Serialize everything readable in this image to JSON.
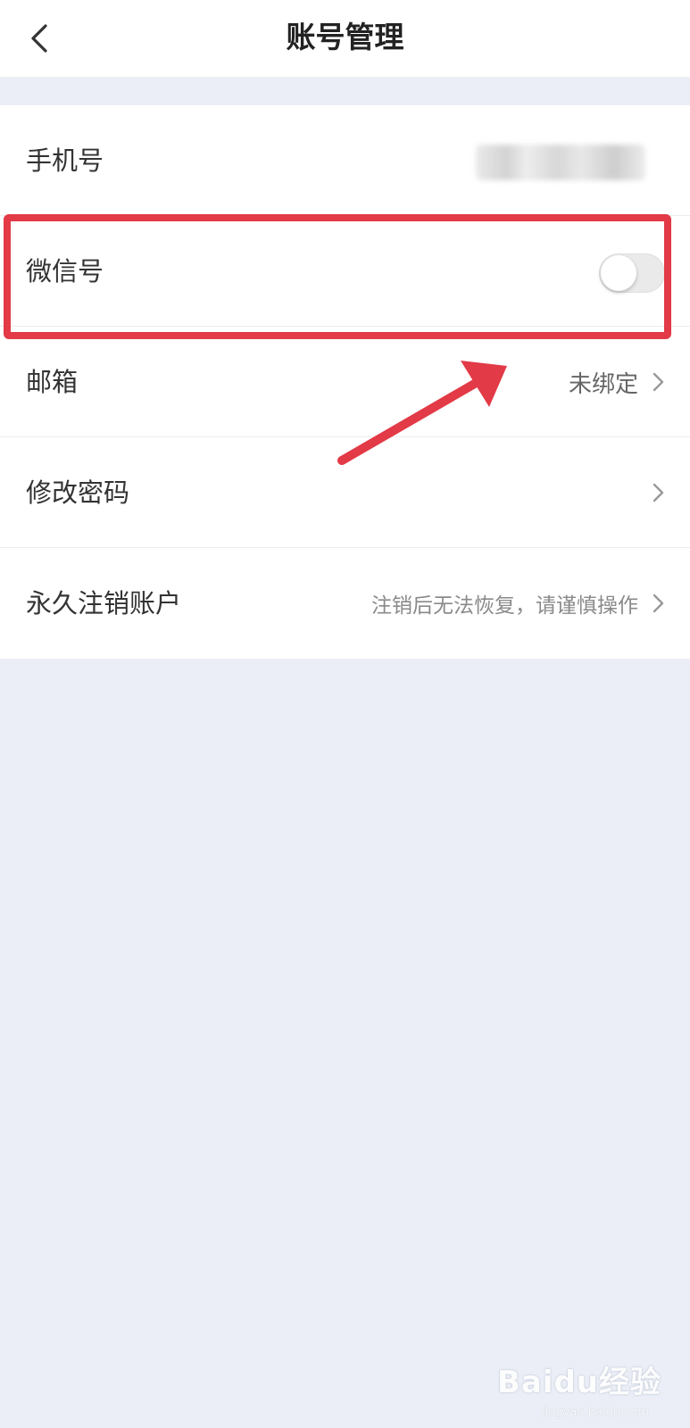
{
  "header": {
    "title": "账号管理",
    "back_icon": "chevron-left-icon"
  },
  "rows": [
    {
      "label": "手机号",
      "value": "",
      "value_state": "blurred"
    },
    {
      "label": "微信号",
      "toggle_on": false
    },
    {
      "label": "邮箱",
      "value": "未绑定"
    },
    {
      "label": "修改密码",
      "value": ""
    },
    {
      "label": "永久注销账户",
      "value": "注销后无法恢复，请谨慎操作"
    }
  ],
  "annotation": {
    "highlight_color": "#e23a46",
    "arrow_color": "#e23a46"
  },
  "watermark": {
    "main": "Baidu经验",
    "sub": "jingyan.baidu.com"
  },
  "colors": {
    "background": "#ebeef6",
    "surface": "#ffffff",
    "text_primary": "#333333",
    "text_secondary": "#8a8a8a"
  }
}
